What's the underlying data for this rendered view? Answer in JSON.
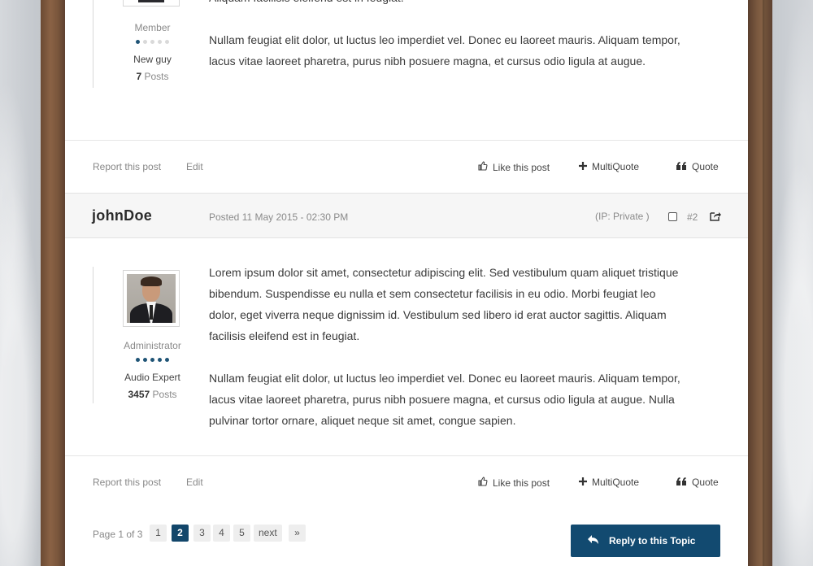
{
  "post1": {
    "author": {
      "role": "Member",
      "level_dots_filled": 1,
      "level_dots_total": 5,
      "rank": "New guy",
      "post_count": "7",
      "posts_label": "Posts"
    },
    "paragraphs": [
      "feugiat leo dolor, eget viverra neque dignissim id. Vestibulum sed libero id erat auctor sagittis. Aliquam facilisis eleifend est in feugiat.",
      "Nullam feugiat elit dolor, ut luctus leo imperdiet vel. Donec eu laoreet mauris. Aliquam tempor, lacus vitae laoreet pharetra, purus nibh posuere magna, et cursus odio ligula at augue."
    ]
  },
  "post2": {
    "username": "johnDoe",
    "posted": "Posted 11 May 2015 - 02:30 PM",
    "ip": "(IP: Private )",
    "number": "#2",
    "author": {
      "role": "Administrator",
      "level_dots_filled": 5,
      "level_dots_total": 5,
      "rank": "Audio Expert",
      "post_count": "3457",
      "posts_label": "Posts"
    },
    "paragraphs": [
      "Lorem ipsum dolor sit amet, consectetur adipiscing elit. Sed vestibulum quam aliquet tristique bibendum. Suspendisse eu nulla et sem consectetur facilisis in eu odio. Morbi feugiat leo dolor, eget viverra neque dignissim id. Vestibulum sed libero id erat auctor sagittis. Aliquam facilisis eleifend est in feugiat.",
      "Nullam feugiat elit dolor, ut luctus leo imperdiet vel. Donec eu laoreet mauris. Aliquam tempor, lacus vitae laoreet pharetra, purus nibh posuere magna, et cursus odio ligula at augue. Nulla pulvinar tortor ornare, aliquet neque sit amet, congue sapien."
    ]
  },
  "actions": {
    "report": "Report this post",
    "edit": "Edit",
    "like": "Like this post",
    "multiquote": "MultiQuote",
    "quote": "Quote"
  },
  "pagination": {
    "label": "Page 1 of 3",
    "pages": [
      "1",
      "2",
      "3",
      "4",
      "5"
    ],
    "current": "2",
    "next": "next",
    "last": "»"
  },
  "reply_button": "Reply to this Topic",
  "colors": {
    "accent": "#12466a",
    "level_dot_on": "#1f5476",
    "level_dot_off": "#d9d9d9"
  },
  "icons": {
    "like": "thumbs-up-icon",
    "multiquote": "plus-icon",
    "quote": "quote-icon",
    "share": "share-icon",
    "reply": "reply-arrow-icon"
  }
}
